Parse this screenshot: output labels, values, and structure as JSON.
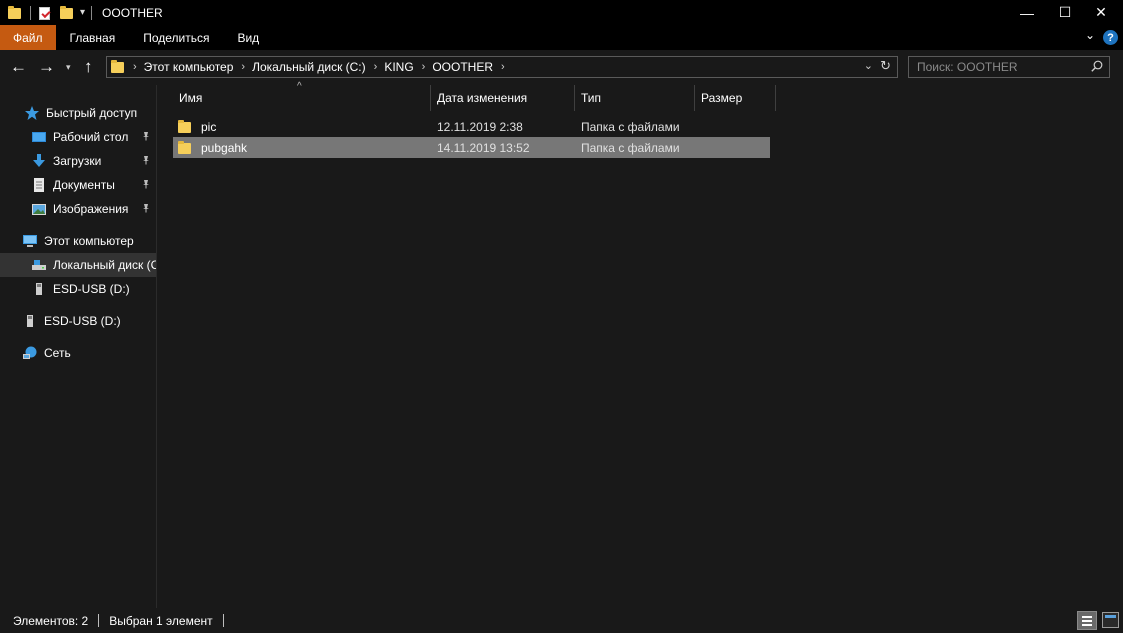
{
  "window": {
    "title": "OOOTHER",
    "minimize_glyph": "—",
    "maximize_glyph": "☐",
    "close_glyph": "✕"
  },
  "quick_access_toolbar": {
    "icons": [
      "folder-icon",
      "properties-icon",
      "new-folder-icon"
    ],
    "dropdown_glyph": "▾"
  },
  "ribbon": {
    "tabs": [
      {
        "label": "Файл"
      },
      {
        "label": "Главная"
      },
      {
        "label": "Поделиться"
      },
      {
        "label": "Вид"
      }
    ],
    "file_tab_color": "#c55a11",
    "expand_glyph": "⌄",
    "help_glyph": "?"
  },
  "navigation": {
    "back_glyph": "←",
    "forward_glyph": "→",
    "recent_glyph": "▾",
    "up_glyph": "↑"
  },
  "address_bar": {
    "crumbs": [
      "Этот компьютер",
      "Локальный диск (C:)",
      "KING",
      "OOOTHER"
    ],
    "separator": "›",
    "dropdown_glyph": "⌄",
    "refresh_glyph": "↻"
  },
  "search": {
    "placeholder": "Поиск: OOOTHER",
    "value": ""
  },
  "nav_pane": {
    "items": [
      {
        "label": "Быстрый доступ",
        "icon": "star-icon"
      },
      {
        "label": "Рабочий стол",
        "icon": "desktop-icon",
        "pinned": true
      },
      {
        "label": "Загрузки",
        "icon": "download-icon",
        "pinned": true
      },
      {
        "label": "Документы",
        "icon": "documents-icon",
        "pinned": true
      },
      {
        "label": "Изображения",
        "icon": "pictures-icon",
        "pinned": true
      },
      {
        "label": "Этот компьютер",
        "icon": "computer-icon"
      },
      {
        "label": "Локальный диск (C",
        "icon": "drive-icon",
        "selected": true
      },
      {
        "label": "ESD-USB (D:)",
        "icon": "usb-drive-icon"
      },
      {
        "label": "ESD-USB (D:)",
        "icon": "usb-drive-icon"
      },
      {
        "label": "Сеть",
        "icon": "network-icon"
      }
    ],
    "pin_glyph": "📌"
  },
  "file_list": {
    "columns": [
      {
        "label": "Имя"
      },
      {
        "label": "Дата изменения"
      },
      {
        "label": "Тип"
      },
      {
        "label": "Размер"
      }
    ],
    "sort_glyph": "^",
    "rows": [
      {
        "name": "pic",
        "date": "12.11.2019 2:38",
        "type": "Папка с файлами",
        "size": "",
        "selected": false
      },
      {
        "name": "pubgahk",
        "date": "14.11.2019 13:52",
        "type": "Папка с файлами",
        "size": "",
        "selected": true
      }
    ],
    "selection_color": "#777777"
  },
  "status_bar": {
    "items_count": "Элементов: 2",
    "selected_count": "Выбран 1 элемент"
  },
  "colors": {
    "background": "#191919",
    "chrome": "#000000",
    "folder": "#f6cf5a",
    "accent": "#1e73be"
  }
}
